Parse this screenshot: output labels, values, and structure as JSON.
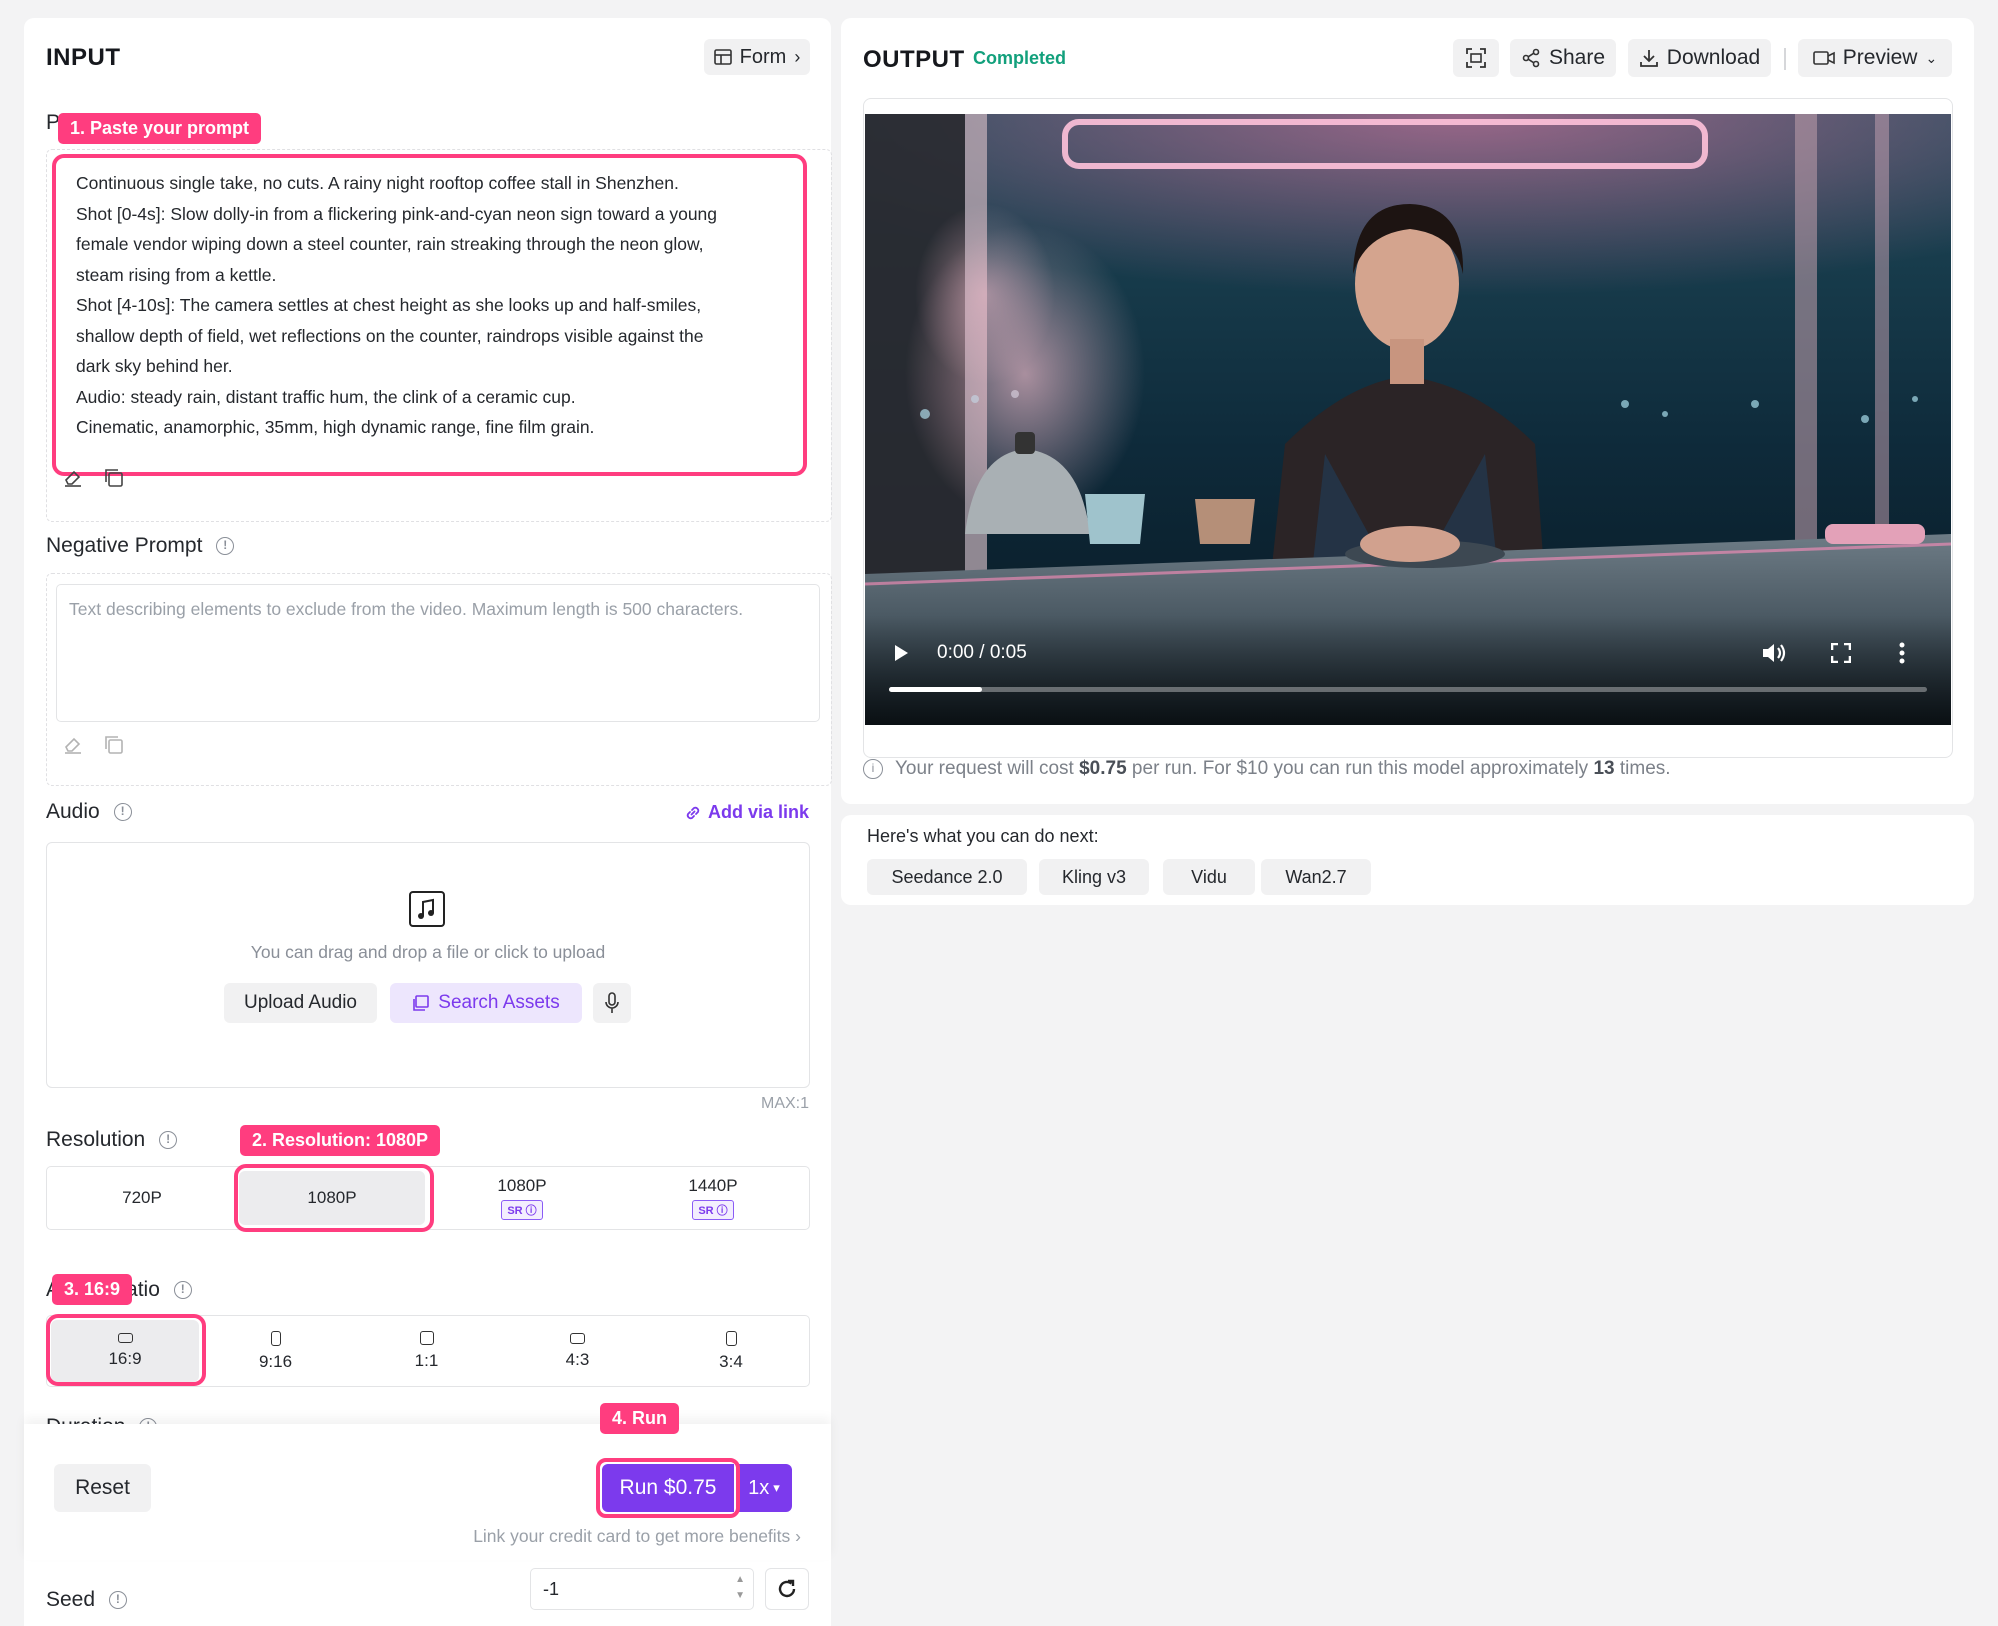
{
  "input": {
    "title": "INPUT",
    "form_label": "Form",
    "prompt_label": "P",
    "prompt_lines": [
      "Continuous single take, no cuts. A rainy night rooftop coffee stall in Shenzhen.",
      "Shot [0-4s]: Slow dolly-in from a flickering pink-and-cyan neon sign toward a young",
      "female vendor wiping down a steel counter, rain streaking through the neon glow,",
      "steam rising from a kettle.",
      "Shot [4-10s]: The camera settles at chest height as she looks up and half-smiles,",
      "shallow depth of field, wet reflections on the counter, raindrops visible against the",
      "dark sky behind her.",
      "Audio: steady rain, distant traffic hum, the clink of a ceramic cup.",
      "Cinematic, anamorphic, 35mm, high dynamic range, fine film grain."
    ],
    "negative_prompt_label": "Negative Prompt",
    "negative_prompt_placeholder": "Text describing elements to exclude from the video. Maximum length is 500 characters.",
    "audio_label": "Audio",
    "add_via_link": "Add via link",
    "audio_drop_text": "You can drag and drop a file or click to upload",
    "upload_audio": "Upload Audio",
    "search_assets": "Search Assets",
    "audio_max": "MAX:1",
    "resolution_label": "Resolution",
    "resolutions": [
      {
        "label": "720P",
        "badge": ""
      },
      {
        "label": "1080P",
        "badge": ""
      },
      {
        "label": "1080P",
        "badge": "SR"
      },
      {
        "label": "1440P",
        "badge": "SR"
      }
    ],
    "aspect_ratio_label_tail": "atio",
    "aspect_ratio_label_head": "A",
    "ratios": [
      "16:9",
      "9:16",
      "1:1",
      "4:3",
      "3:4"
    ],
    "duration_label": "Duration",
    "reset": "Reset",
    "run": "Run $0.75",
    "multiplier": "1x",
    "credit_link": "Link your credit card to get more benefits",
    "seed_label": "Seed",
    "seed_value": "-1"
  },
  "annotations": {
    "a1": "1. Paste your prompt",
    "a2": "2. Resolution: 1080P",
    "a3": "3. 16:9",
    "a4": "4. Run"
  },
  "output": {
    "title": "OUTPUT",
    "status": "Completed",
    "share": "Share",
    "download": "Download",
    "preview": "Preview",
    "video_time": "0:00 / 0:05",
    "video_progress": 0.09,
    "cost_prefix": "Your request will cost ",
    "cost_value": "$0.75",
    "cost_mid": " per run. For $10 you can run this model approximately ",
    "cost_count": "13",
    "cost_suffix": " times."
  },
  "next": {
    "title": "Here's what you can do next:",
    "items": [
      "Seedance 2.0",
      "Kling v3",
      "Vidu",
      "Wan2.7"
    ]
  },
  "colors": {
    "accent": "#7c3aed",
    "annotation": "#ff3d7f",
    "status": "#12a07c"
  }
}
